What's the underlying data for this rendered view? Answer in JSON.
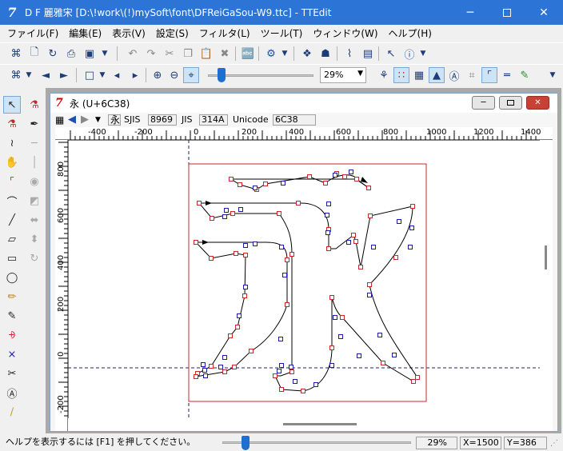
{
  "window": {
    "title": "D F 麗雅宋 [D:\\!work\\(!)mySoft\\font\\DFReiGaSou-W9.ttc] - TTEdit",
    "app_icon": "7"
  },
  "menu": [
    "ファイル(F)",
    "編集(E)",
    "表示(V)",
    "設定(S)",
    "フィルタ(L)",
    "ツール(T)",
    "ウィンドウ(W)",
    "ヘルプ(H)"
  ],
  "toolbar": {
    "zoom_value": "29%"
  },
  "glyph_window": {
    "title": "永 (U+6C38)",
    "icon": "7",
    "char": "永",
    "sjis_label": "SJIS",
    "sjis_value": "8969",
    "jis_label": "JIS",
    "jis_value": "314A",
    "unicode_label": "Unicode",
    "unicode_value": "6C38"
  },
  "ruler": {
    "h_labels": [
      "-400",
      "-200",
      "0",
      "200",
      "400",
      "600",
      "800",
      "1000",
      "1200",
      "1400"
    ],
    "v_labels": [
      "800",
      "600",
      "400",
      "200",
      "0",
      "-200"
    ]
  },
  "status": {
    "help": "ヘルプを表示するには [F1] を押してください。",
    "zoom": "29%",
    "x": "X=1500",
    "y": "Y=386"
  },
  "icons": {
    "toolbar1": [
      "new-font-icon",
      "new-file-icon",
      "open-icon",
      "print-icon",
      "save-icon",
      "undo-icon",
      "redo-icon",
      "cut-icon",
      "copy-icon",
      "paste-icon",
      "delete-icon",
      "font-info-icon",
      "settings-gear-icon",
      "glyph-icon",
      "glyph-list-icon",
      "bitmap-icon",
      "window-icon",
      "help-pointer-icon",
      "help-icon"
    ],
    "toolbar2": [
      "glyph-nav-icon",
      "prev-glyph-icon",
      "next-glyph-icon",
      "page-icon",
      "left-icon",
      "right-icon",
      "zoom-in-icon",
      "zoom-out-icon",
      "fit-icon",
      "fill-icon",
      "points-icon",
      "guide-icon",
      "text-icon",
      "grid-icon",
      "ruler-icon",
      "baseline-icon",
      "brush-icon"
    ]
  },
  "colors": {
    "titlebar": "#2c74d6",
    "glyph_box": "#c8282d",
    "on_curve_point": "#c8282d",
    "off_curve_point": "#1c1ca8",
    "baseline": "#20206a"
  }
}
